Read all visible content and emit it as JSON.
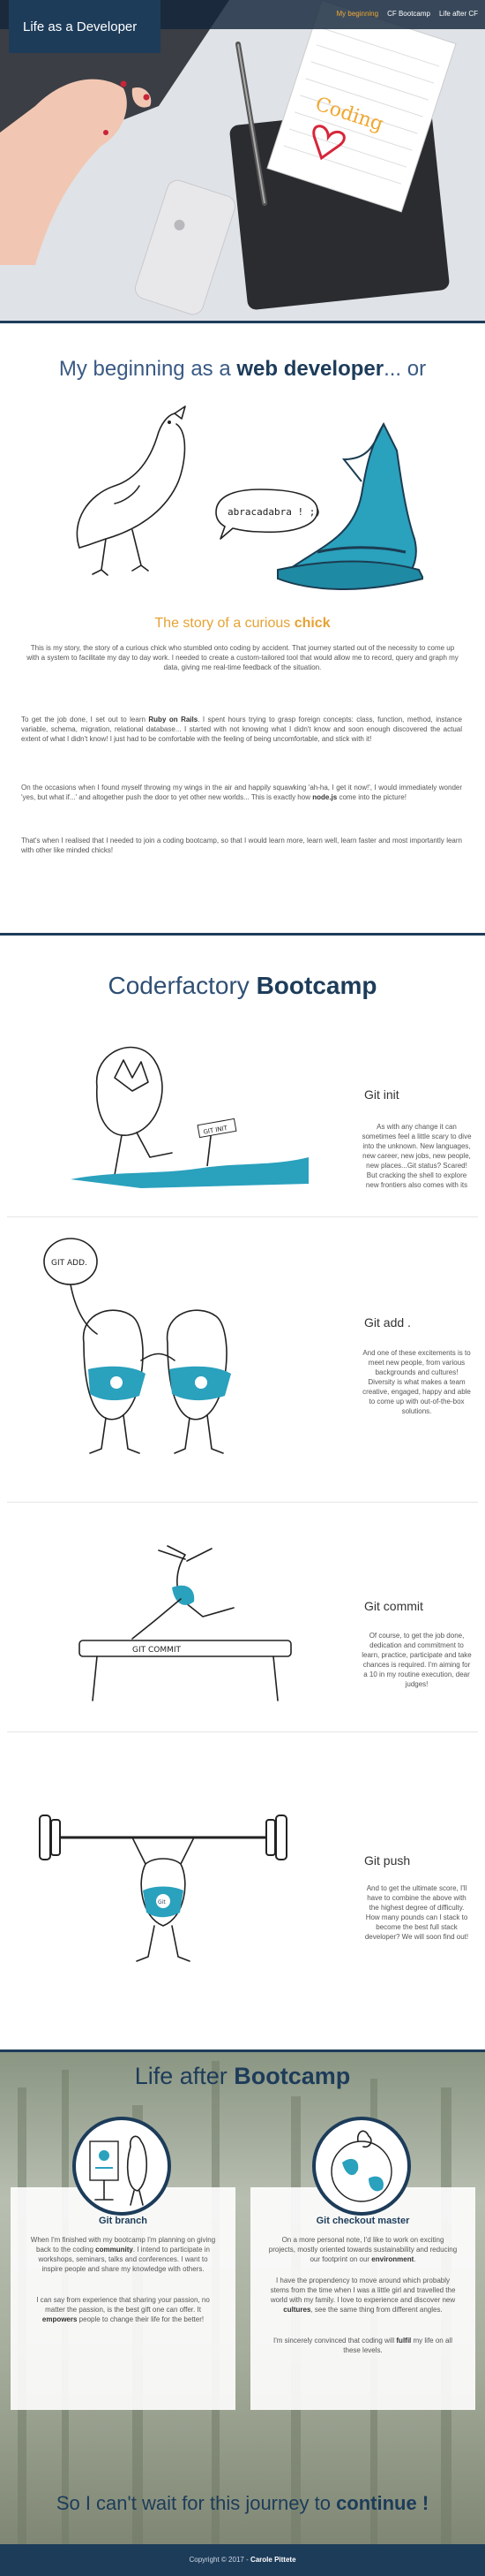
{
  "nav": {
    "brand": "Life as a Developer",
    "links": [
      "My beginning",
      "CF Bootcamp",
      "Life after CF"
    ]
  },
  "hero": {
    "notebook_word": "Coding"
  },
  "intro": {
    "title_pre": "My beginning as a ",
    "title_bold": "web developer",
    "title_post": "... or",
    "speech_bubble": "abracadabra ! ;)",
    "story_title_pre": "The story of a curious ",
    "story_title_bold": "chick",
    "p1": "This is my story, the story of a curious chick who stumbled onto coding by accident. That journey started out of the necessity to come up with a system to facilitate my day to day work. I needed to create a custom-tailored tool that would allow me to record, query and graph my data, giving me real-time feedback of the situation.",
    "p2_a": "To get the job done, I set out to learn ",
    "p2_b": "Ruby on Rails",
    "p2_c": ". I spent hours trying to grasp foreign concepts: class, function, method, instance variable, schema, migration, relational database... I started with not knowing what I didn't know and soon enough discovered the actual extent of what I didn't know! I just had to be comfortable with the feeling of being uncomfortable, and stick with it!",
    "p3_a": "On the occasions when I found myself throwing my wings in the air and happily squawking 'ah-ha, I get it now!', I would immediately wonder 'yes, but what if...' and altogether push the door to yet other new worlds... This is exactly how ",
    "p3_b": "node.js",
    "p3_c": " come into the picture!",
    "p4": "That's when I realised that I needed to join a coding bootcamp, so that I would learn more, learn well, learn faster and most importantly learn with other like minded chicks!"
  },
  "bootcamp": {
    "title_pre": "Coderfactory ",
    "title_bold": "Bootcamp",
    "steps": [
      {
        "title": "Git init",
        "sign": "GIT INIT",
        "text": "As with any change it can sometimes feel a little scary to dive into the unknown. New languages, new career, new jobs, new people, new places...Git status? Scared! But cracking the shell to explore new frontiers also comes with its"
      },
      {
        "title": "Git add .",
        "balloon": "GIT ADD.",
        "text": "And one of these excitements is to meet new people, from various backgrounds and cultures! Diversity is what makes a team creative, engaged, happy and able to come up with out-of-the-box solutions."
      },
      {
        "title": "Git commit",
        "beam": "GIT COMMIT",
        "text": "Of course, to get the job done, dedication and commitment to learn, practice, participate and take chances is required. I'm aiming for a 10 in my routine execution, dear judges!"
      },
      {
        "title": "Git push",
        "badge": "Git",
        "text": "And to get the ultimate score, I'll have to combine the above with the highest degree of difficulty. How many pounds can I stack to become the best full stack developer? We will soon find out!"
      }
    ]
  },
  "after": {
    "title_pre": "Life after ",
    "title_bold": "Bootcamp",
    "cards": [
      {
        "title": "Git branch",
        "p1_a": "When I'm finished with my bootcamp I'm planning on giving back to the coding ",
        "p1_b": "community",
        "p1_c": ". I intend to participate in workshops, seminars, talks and conferences. I want to inspire people and share my knowledge with others.",
        "p2_a": "I can say from experience that sharing your passion, no matter the passion, is the best gift one can offer. It ",
        "p2_b": "empowers",
        "p2_c": " people to change their life for the better!"
      },
      {
        "title": "Git checkout master",
        "p1_a": "On a more personal note, I'd like to work on exciting projects, mostly oriented towards sustainability and reducing our footprint on our ",
        "p1_b": "environment",
        "p1_c": ".",
        "p2_a": "I have the propendency to move around which probably stems from the time when I was a little girl and travelled the world with my family. I love to experience and discover new ",
        "p2_b": "cultures",
        "p2_c": ", see the same thing from different angles.",
        "p3_a": "I'm sincerely convinced that coding will ",
        "p3_b": "fulfil",
        "p3_c": " my life on all these levels."
      }
    ],
    "final_pre": "So I can't wait for this journey to ",
    "final_bold": "continue !"
  },
  "footer": {
    "pre": "Copyright © 2017 - ",
    "name": "Carole Pittete"
  },
  "colors": {
    "navy": "#1d3c5a",
    "accent": "#f0a830",
    "teal": "#2aa1bd"
  }
}
